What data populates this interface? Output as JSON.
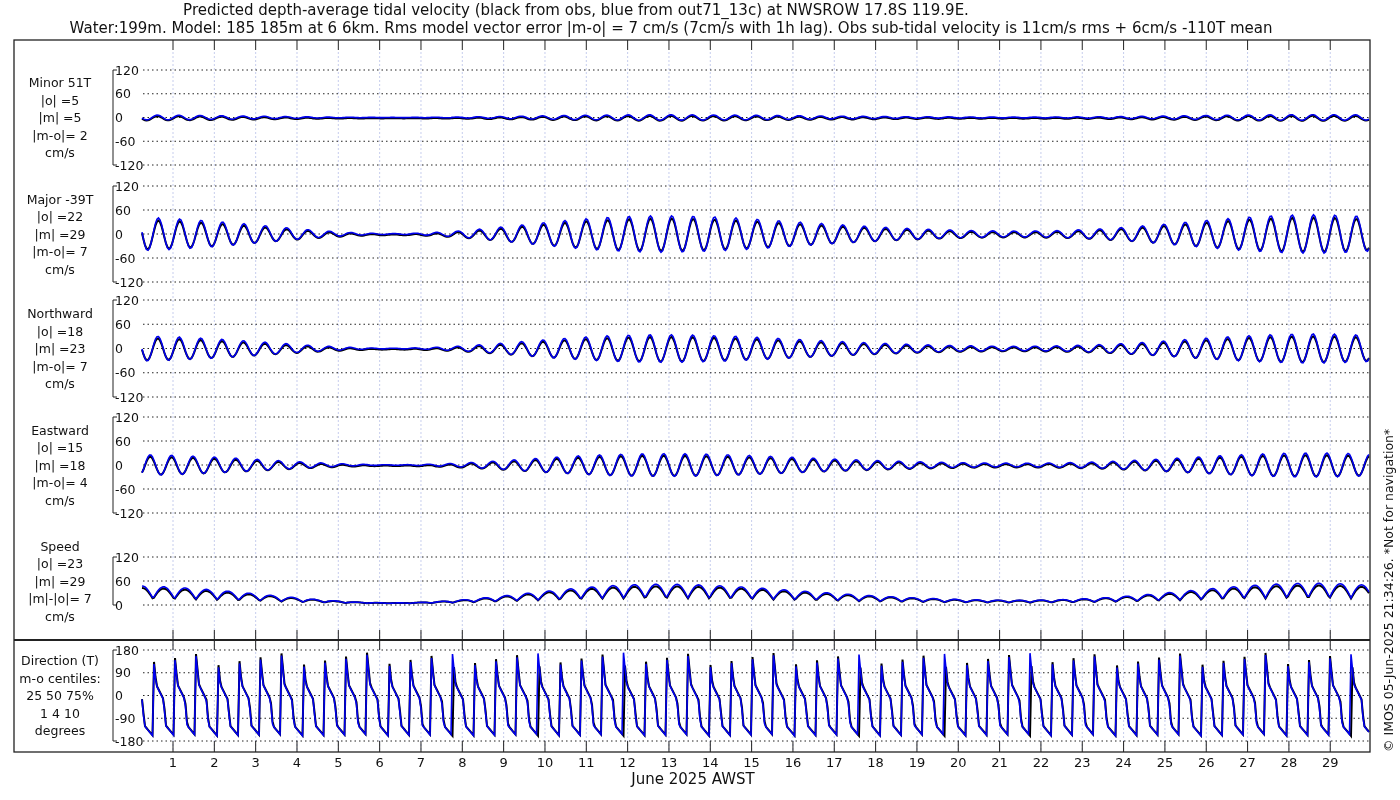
{
  "title_lines": [
    "Predicted depth-average tidal velocity (black from obs, blue from out71_13c) at NWSROW 17.8S 119.9E.",
    "Water:199m. Model: 185 185m at 6 6km. Rms model vector error |m-o| = 7 cm/s (7cm/s with 1h lag). Obs sub-tidal velocity is 11cm/s rms + 6cm/s -110T mean"
  ],
  "panels": [
    {
      "kind": "velocity",
      "label_lines": [
        "Minor 51T",
        "|o| =5",
        "|m| =5",
        "|m-o|= 2",
        "cm/s"
      ],
      "yticks": [
        "120",
        "60",
        "0",
        "-60",
        "-120"
      ]
    },
    {
      "kind": "velocity",
      "label_lines": [
        "Major -39T",
        "|o| =22",
        "|m| =29",
        "|m-o|= 7",
        "cm/s"
      ],
      "yticks": [
        "120",
        "60",
        "0",
        "-60",
        "-120"
      ]
    },
    {
      "kind": "velocity",
      "label_lines": [
        "Northward",
        "|o| =18",
        "|m| =23",
        "|m-o|= 7",
        "cm/s"
      ],
      "yticks": [
        "120",
        "60",
        "0",
        "-60",
        "-120"
      ]
    },
    {
      "kind": "velocity",
      "label_lines": [
        "Eastward",
        "|o| =15",
        "|m| =18",
        "|m-o|= 4",
        "cm/s"
      ],
      "yticks": [
        "120",
        "60",
        "0",
        "-60",
        "-120"
      ]
    },
    {
      "kind": "speed",
      "label_lines": [
        "Speed",
        "|o| =23",
        "|m| =29",
        "|m|-|o|= 7",
        "cm/s"
      ],
      "yticks": [
        "120",
        "60",
        "0"
      ]
    },
    {
      "kind": "direction",
      "label_lines": [
        "Direction (T)",
        "m-o centiles:",
        "25  50  75%",
        "1  4 10",
        "degrees"
      ],
      "yticks": [
        "180",
        "90",
        "0",
        "-90",
        "-180"
      ]
    }
  ],
  "x_axis": {
    "ticks": [
      {
        "label": "1"
      },
      {
        "label": "2"
      },
      {
        "label": "3"
      },
      {
        "label": "4"
      },
      {
        "label": "5"
      },
      {
        "label": "6"
      },
      {
        "label": "7"
      },
      {
        "label": "8"
      },
      {
        "label": "9"
      },
      {
        "label": "10"
      },
      {
        "label": "11"
      },
      {
        "label": "12"
      },
      {
        "label": "13"
      },
      {
        "label": "14"
      },
      {
        "label": "15"
      },
      {
        "label": "16"
      },
      {
        "label": "17"
      },
      {
        "label": "18"
      },
      {
        "label": "19"
      },
      {
        "label": "20"
      },
      {
        "label": "21"
      },
      {
        "label": "22"
      },
      {
        "label": "23"
      },
      {
        "label": "24"
      },
      {
        "label": "25"
      },
      {
        "label": "26"
      },
      {
        "label": "27"
      },
      {
        "label": "28"
      },
      {
        "label": "29"
      }
    ],
    "label": "June 2025 AWST"
  },
  "credit": "© IMOS 05-Jun-2025 21:34:26. *Not for navigation*"
}
